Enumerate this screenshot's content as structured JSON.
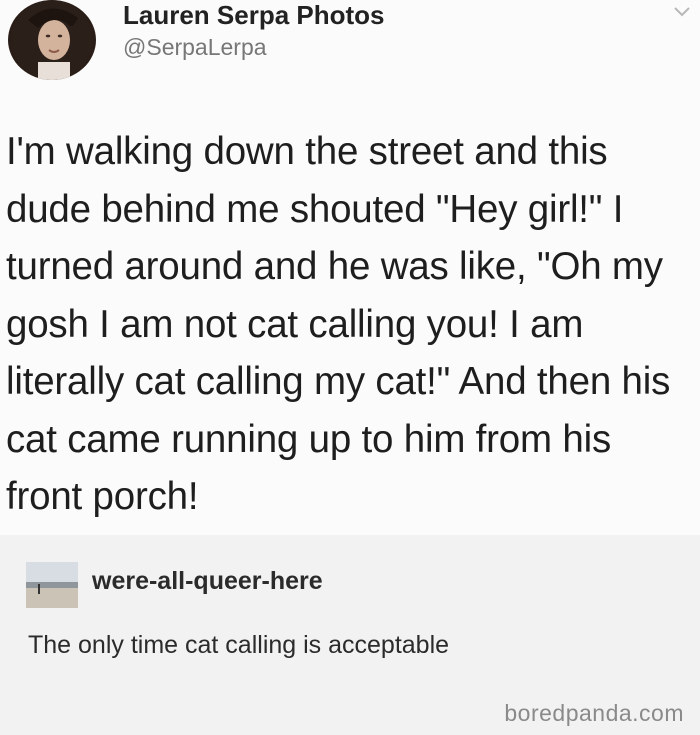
{
  "tweet": {
    "author_name": "Lauren Serpa Photos",
    "author_handle": "@SerpaLerpa",
    "text": "I'm walking down the street and this dude behind me shouted \"Hey girl!\" I turned around and he was like, \"Oh my gosh I am not cat calling you! I am literally cat calling my cat!\" And then his cat came running up to him from his front porch!",
    "menu_icon": "chevron-down-icon"
  },
  "reblog": {
    "username": "were-all-queer-here",
    "comment": "The only time cat calling is acceptable"
  },
  "watermark": "boredpanda.com"
}
